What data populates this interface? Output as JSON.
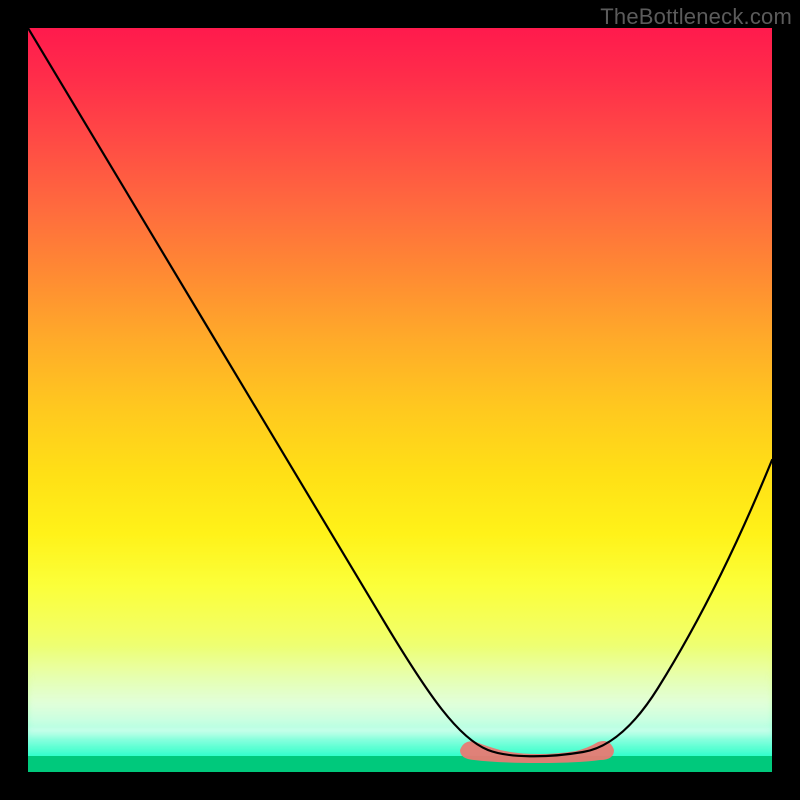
{
  "watermark": "TheBottleneck.com",
  "colors": {
    "black": "#000000",
    "salmon": "#e87a73",
    "green_bar": "#00c97c",
    "gradient_top": "#ff1a4d",
    "gradient_mid": "#ffe016",
    "gradient_bottom": "#00e696",
    "curve": "#000000"
  },
  "chart_data": {
    "type": "line",
    "title": "",
    "xlabel": "",
    "ylabel": "",
    "xlim": [
      0,
      100
    ],
    "ylim": [
      0,
      100
    ],
    "background": "vertical-rainbow-gradient",
    "series": [
      {
        "name": "curve",
        "x": [
          0,
          5,
          10,
          15,
          20,
          25,
          30,
          35,
          40,
          45,
          50,
          55,
          58,
          60,
          63,
          66,
          70,
          74,
          78,
          82,
          86,
          90,
          94,
          97,
          100
        ],
        "y": [
          100,
          93,
          85,
          77,
          69,
          61,
          53,
          45,
          38,
          30,
          22,
          14,
          8,
          4,
          2,
          1,
          1,
          1,
          2,
          5,
          10,
          17,
          25,
          33,
          42
        ]
      }
    ],
    "highlight": {
      "name": "salmon-trough-marker",
      "x_range": [
        58,
        78
      ],
      "y_approx": 1.5
    },
    "annotations": []
  }
}
